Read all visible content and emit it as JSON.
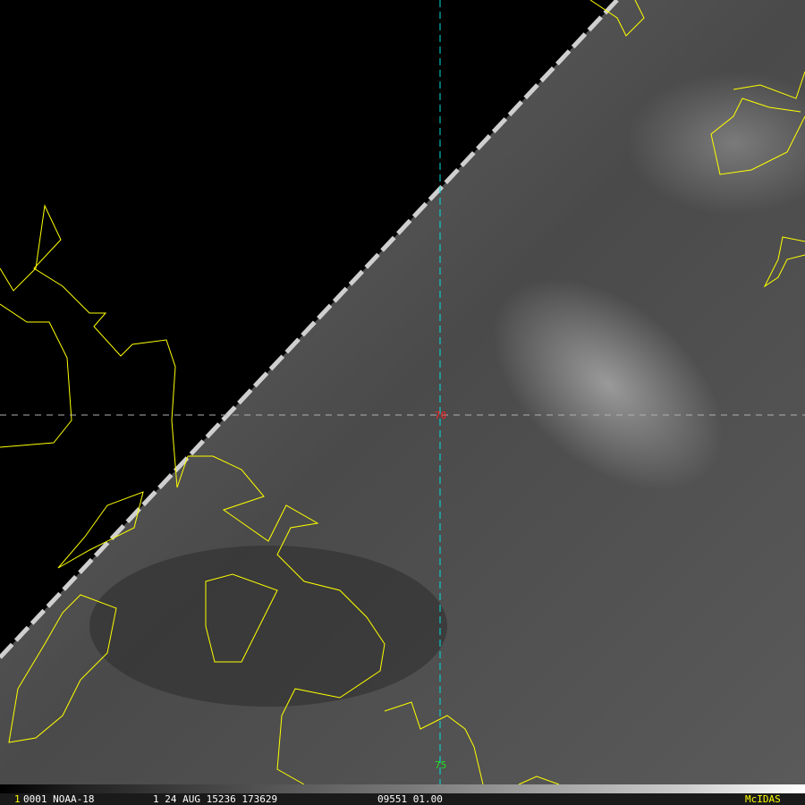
{
  "image": {
    "frame_number": "1",
    "status_line": {
      "sat_info": "0001 NOAA-18",
      "date_time": "1 24 AUG 15236 173629",
      "band_info": "09551 01.00",
      "brand": "McIDAS"
    },
    "latitude_label": "70",
    "longitude_label": "75",
    "colors": {
      "coastline": "#ffff00",
      "lat_label": "#ff2020",
      "lon_label": "#20e020",
      "lon_line": "#00e0e0",
      "lat_line": "#b0b0b0",
      "brand": "#ffff00"
    }
  }
}
